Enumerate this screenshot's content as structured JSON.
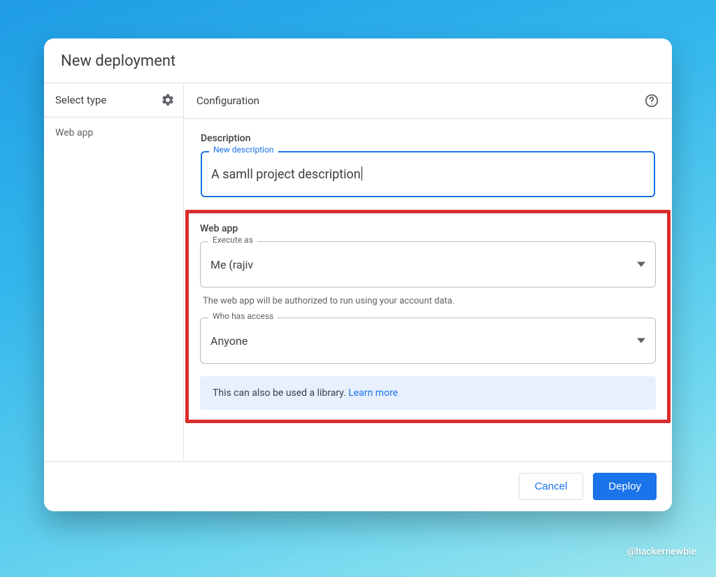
{
  "dialog": {
    "title": "New deployment"
  },
  "sidebar": {
    "header": "Select type",
    "items": [
      {
        "label": "Web app"
      }
    ]
  },
  "main": {
    "header": "Configuration",
    "description_label": "Description",
    "description_field": {
      "notch": "New description",
      "value": "A samll project description"
    },
    "webapp": {
      "label": "Web app",
      "execute_as": {
        "notch": "Execute as",
        "value": "Me (rajiv"
      },
      "execute_helper": "The web app will be authorized to run using your account data.",
      "access": {
        "notch": "Who has access",
        "value": "Anyone"
      }
    },
    "banner": {
      "text": "This can also be used a library. ",
      "link": "Learn more"
    }
  },
  "footer": {
    "cancel": "Cancel",
    "deploy": "Deploy"
  },
  "watermark": "@hackernewbie"
}
